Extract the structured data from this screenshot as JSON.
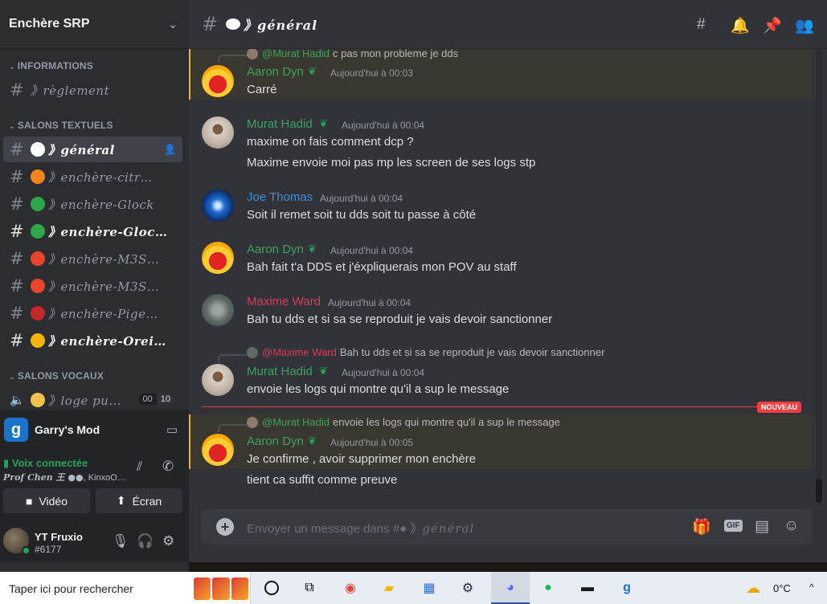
{
  "server": {
    "name": "Enchère SRP"
  },
  "categories": {
    "info": "INFORMATIONS",
    "text": "SALONS TEXTUELS",
    "voice": "SALONS VOCAUX"
  },
  "channels": [
    {
      "name": "》règlement",
      "emoji_color": ""
    },
    {
      "name": "》général",
      "emoji_color": "#ffffff"
    },
    {
      "name": "》enchère-citr…",
      "emoji_color": "#f5841f"
    },
    {
      "name": "》enchère-Glock",
      "emoji_color": "#2fa64a"
    },
    {
      "name": "》enchère-Gloc…",
      "emoji_color": "#2fa64a"
    },
    {
      "name": "》enchère-M3S…",
      "emoji_color": "#e8452c"
    },
    {
      "name": "》enchère-M3S…",
      "emoji_color": "#e8452c"
    },
    {
      "name": "》enchère-Pige…",
      "emoji_color": "#c62828"
    },
    {
      "name": "》enchère-Orei…",
      "emoji_color": "#f5b400"
    }
  ],
  "voice_channel": {
    "name": "》loge pu…",
    "count_left": "00",
    "count_right": "10",
    "emoji_color": "#f2c14e"
  },
  "activity": {
    "game_icon": "g",
    "game_name": "Garry's Mod"
  },
  "voice_status": {
    "status": "Voix connectée",
    "user": "Prof Chen 王 ●●",
    "rest": ", KinxoO…"
  },
  "voice_buttons": {
    "video": "Vidéo",
    "screen": "Écran"
  },
  "user": {
    "name": "YT Fruxio",
    "tag": "#6177"
  },
  "channel_header": {
    "title": "général"
  },
  "messages": [
    {
      "reply_author": "@Murat Hadid",
      "reply_text": "c pas mon probleme je dds",
      "author": "Aaron Dyn",
      "time": "Aujourd'hui à 00:03",
      "lines": [
        "Carré"
      ]
    },
    {
      "author": "Murat Hadid",
      "time": "Aujourd'hui à 00:04",
      "lines": [
        "maxime on fais comment dcp ?",
        "Maxime envoie moi pas mp les screen de ses logs stp"
      ]
    },
    {
      "author": "Joe Thomas",
      "time": "Aujourd'hui à 00:04",
      "lines": [
        "Soit il remet soit tu dds soit tu passe à côté"
      ]
    },
    {
      "author": "Aaron Dyn",
      "time": "Aujourd'hui à 00:04",
      "lines": [
        "Bah fait t'a DDS et j'éxpliquerais mon POV au staff"
      ]
    },
    {
      "author": "Maxime Ward",
      "time": "Aujourd'hui à 00:04",
      "lines": [
        "Bah tu dds et si sa se reproduit je vais devoir sanctionner"
      ]
    },
    {
      "reply_author": "@Maxime Ward",
      "reply_text": "Bah tu dds et si sa se reproduit je vais devoir sanctionner",
      "author": "Murat Hadid",
      "time": "Aujourd'hui à 00:04",
      "lines": [
        "envoie les logs qui montre qu'il a sup le message"
      ]
    },
    {
      "reply_author": "@Murat Hadid",
      "reply_text": "envoie les logs qui montre qu'il a sup le message",
      "author": "Aaron Dyn",
      "time": "Aujourd'hui à 00:05",
      "lines": [
        "Je confirme , avoir supprimer mon enchère",
        "tient ca suffit comme preuve"
      ]
    }
  ],
  "new_badge": "NOUVEAU",
  "composer": {
    "placeholder": "Envoyer un message dans #",
    "channel": "général",
    "gif": "GIF"
  },
  "colors": {
    "aaron": "#3ba55c",
    "murat": "#3ba55c",
    "joe": "#3d8fd6",
    "maxime": "#d83c5b"
  },
  "taskbar": {
    "search": "Taper ici pour rechercher",
    "temperature": "0°C"
  }
}
